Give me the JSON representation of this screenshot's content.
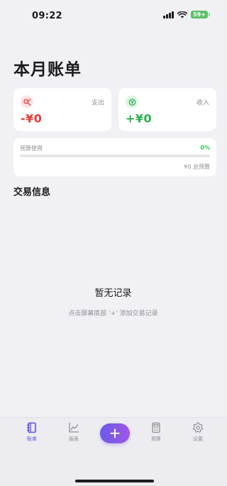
{
  "status_bar": {
    "time": "09:22",
    "battery": "59+"
  },
  "page": {
    "title": "本月账单"
  },
  "expense_card": {
    "label": "支出",
    "value": "-¥0",
    "icon": "expense-icon"
  },
  "income_card": {
    "label": "收入",
    "value": "+¥0",
    "icon": "income-icon"
  },
  "budget": {
    "label": "预算使用",
    "percent_text": "0%",
    "used_fraction": 0,
    "total_text": "¥0 总预算"
  },
  "transactions": {
    "title": "交易信息",
    "empty_title": "暂无记录",
    "empty_hint": "点击屏幕底部 '+' 添加交易记录"
  },
  "tabs": [
    {
      "label": "账单",
      "icon": "bill-book-icon",
      "active": true
    },
    {
      "label": "报表",
      "icon": "line-chart-icon",
      "active": false
    },
    {
      "label": "预算",
      "icon": "calculator-icon",
      "active": false
    },
    {
      "label": "设置",
      "icon": "gear-icon",
      "active": false
    }
  ],
  "add_button": {
    "icon": "plus-icon"
  },
  "colors": {
    "accent": "#5b53e0",
    "expense": "#e53935",
    "income": "#2eae4f",
    "progress": "#34c759"
  }
}
